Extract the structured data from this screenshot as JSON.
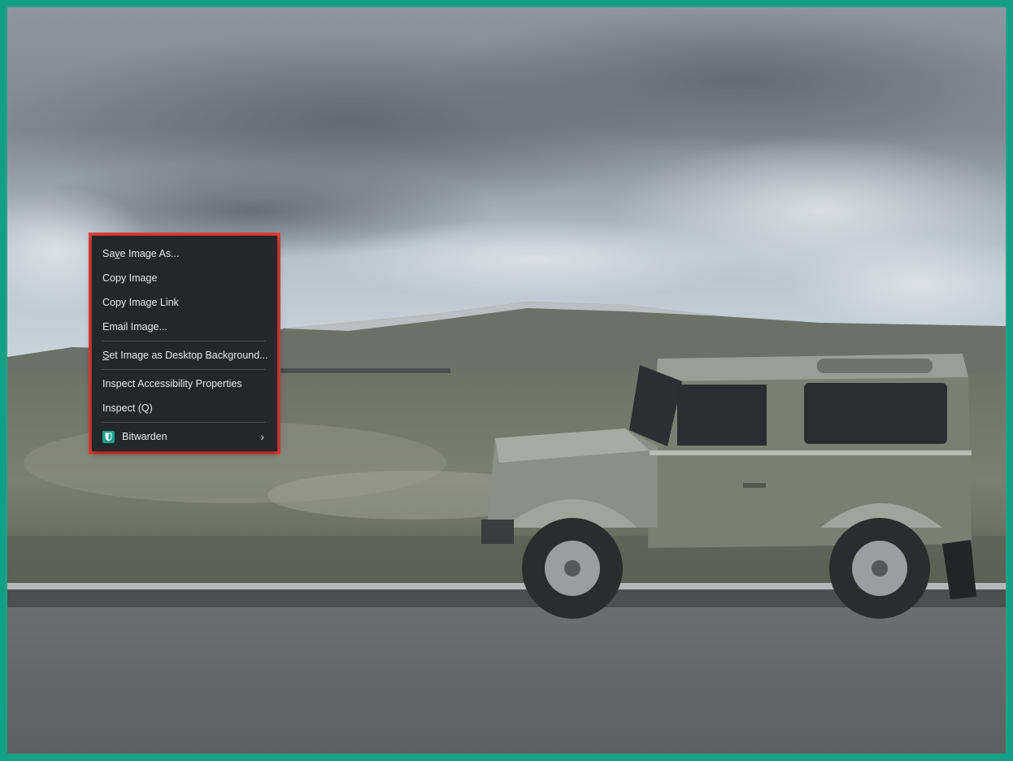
{
  "context_menu": {
    "items": [
      {
        "pre": "Sa",
        "ul": "v",
        "post": "e Image As..."
      },
      {
        "pre": "",
        "ul": "",
        "post": "Copy Image"
      },
      {
        "pre": "",
        "ul": "",
        "post": "Copy Image Link"
      },
      {
        "pre": "",
        "ul": "",
        "post": "Email Image..."
      },
      {
        "pre": "",
        "ul": "S",
        "post": "et Image as Desktop Background..."
      },
      {
        "pre": "",
        "ul": "",
        "post": "Inspect Accessibility Properties"
      },
      {
        "pre": "",
        "ul": "",
        "post": "Inspect (Q)"
      }
    ],
    "submenu": {
      "label": "Bitwarden",
      "icon": "bitwarden-shield-icon",
      "chevron": "›"
    }
  },
  "colors": {
    "frame": "#12a085",
    "highlight": "#e8403a",
    "menu_bg": "#23262a",
    "bitwarden": "#1a9f8a"
  }
}
